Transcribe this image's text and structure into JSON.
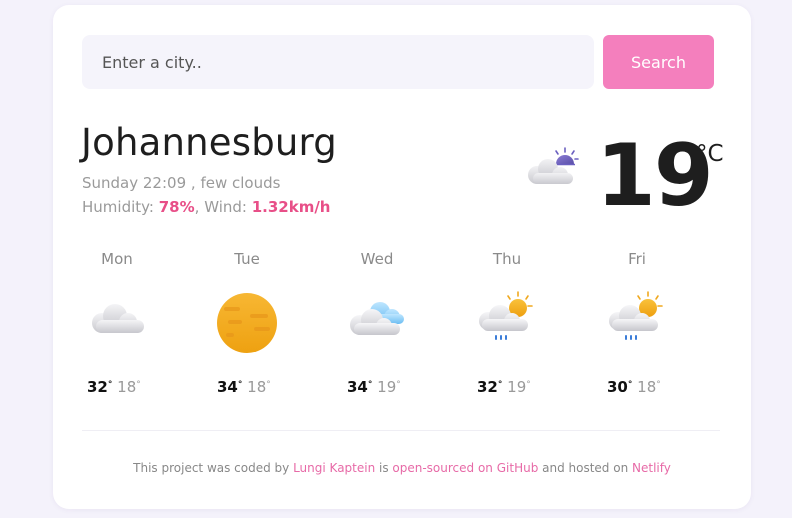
{
  "search": {
    "placeholder": "Enter a city..",
    "button_label": "Search"
  },
  "current": {
    "city": "Johannesburg",
    "datetime": "Sunday 22:09",
    "description": ", few clouds",
    "humidity_label": "Humidity: ",
    "humidity_value": "78%",
    "wind_label": ", Wind: ",
    "wind_value": "1.32km/h",
    "temperature": "19",
    "unit": "°C",
    "icon": "night-few-clouds-icon"
  },
  "forecast": [
    {
      "day": "Mon",
      "max": "32",
      "min": "18",
      "icon": "cloudy-icon"
    },
    {
      "day": "Tue",
      "max": "34",
      "min": "18",
      "icon": "sun-haze-icon"
    },
    {
      "day": "Wed",
      "max": "34",
      "min": "19",
      "icon": "partly-cloudy-icon"
    },
    {
      "day": "Thu",
      "max": "32",
      "min": "19",
      "icon": "sun-rain-icon"
    },
    {
      "day": "Fri",
      "max": "30",
      "min": "18",
      "icon": "sun-rain-icon"
    }
  ],
  "footer": {
    "text_1": "This project was coded by ",
    "link_author": "Lungi Kaptein",
    "text_2": " is ",
    "link_github": "open-sourced on GitHub",
    "text_3": " and hosted on ",
    "link_host": "Netlify"
  },
  "colors": {
    "accent": "#f47fbd",
    "highlight": "#e84f88"
  }
}
